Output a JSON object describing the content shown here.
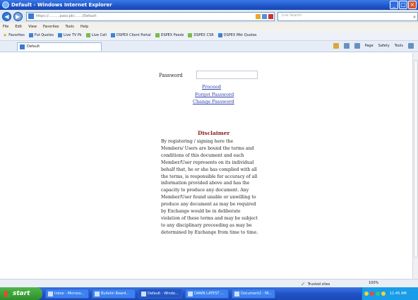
{
  "window": {
    "title": "Default - Windows Internet Explorer"
  },
  "address_bar": {
    "url": "https://..........pass.pk/......./Default",
    "search_placeholder": "Live Search"
  },
  "menu": {
    "items": [
      "File",
      "Edit",
      "View",
      "Favorites",
      "Tools",
      "Help"
    ]
  },
  "favorites": {
    "label": "Favorites",
    "items": [
      "Fut Quotes",
      "Live TV Pk",
      "Live Cell",
      "DSPEX Client Portal",
      "DSPEX Feeds",
      "DSPEX CSR",
      "DSPEX Mkt Quotes"
    ]
  },
  "tab": {
    "label": "Default"
  },
  "command_bar": {
    "page": "Page",
    "safety": "Safety",
    "tools": "Tools"
  },
  "login": {
    "password_label": "Password",
    "password_value": "",
    "proceed": "Proceed",
    "forgot": "Forgot Password",
    "change": "Change Password"
  },
  "disclaimer": {
    "title": "Disclaimer",
    "lines": [
      "By registering / signing here the",
      "Members/ Users are bound the terms and",
      "conditions of this document and each",
      "Member/User represents on its individual",
      "behalf that, he or she has complied with all",
      "the terms, is responsible for accuracy of all",
      "information provided above and has the",
      "capacity to produce any document. Any",
      "Member/User found unable or unwilling to",
      "produce any document as may be required",
      "by Exchange would be in deliberate",
      "violation of these terms and may be subject",
      "to any disciplinary proceeding as may be",
      "determined by Exchange from time to time."
    ]
  },
  "status": {
    "zone": "Trusted sites",
    "zoom": "100%"
  },
  "taskbar": {
    "start": "start",
    "tasks": [
      "Inbox - Microso...",
      "Bulletin Board...",
      "Default - Windo...",
      "DAWN LATEST ...",
      "Document2 - Mi..."
    ],
    "clock": "11:45 AM"
  }
}
